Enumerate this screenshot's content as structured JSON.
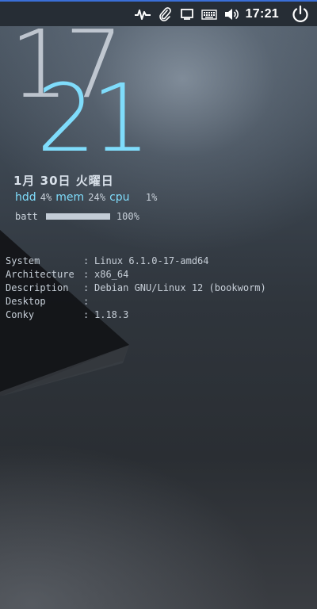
{
  "panel": {
    "clock": "17:21",
    "accent_color": "#3a6fd8",
    "tray_icons": [
      "activity-icon",
      "paperclip-icon",
      "display-icon",
      "keyboard-icon",
      "volume-icon"
    ],
    "power_icon": "power-icon"
  },
  "conky": {
    "hour": "17",
    "minute": "21",
    "date": "1月 30日 火曜日",
    "stats": {
      "hdd_label": "hdd",
      "hdd_value": "4%",
      "mem_label": "mem",
      "mem_value": "24%",
      "cpu_label": "cpu",
      "cpu_value": "1%"
    },
    "battery": {
      "label": "batt",
      "value": "100%",
      "level": 1.0
    },
    "colors": {
      "accent": "#7fdcfb",
      "text": "#c6ced7"
    }
  },
  "sysinfo": [
    {
      "key": "System",
      "sep": ":",
      "value": "Linux 6.1.0-17-amd64"
    },
    {
      "key": "Architecture",
      "sep": ":",
      "value": "x86_64"
    },
    {
      "key": "Description",
      "sep": ":",
      "value": "Debian GNU/Linux 12 (bookworm)"
    },
    {
      "key": "Desktop",
      "sep": ":",
      "value": ""
    },
    {
      "key": "Conky",
      "sep": ":",
      "value": "1.18.3"
    }
  ]
}
